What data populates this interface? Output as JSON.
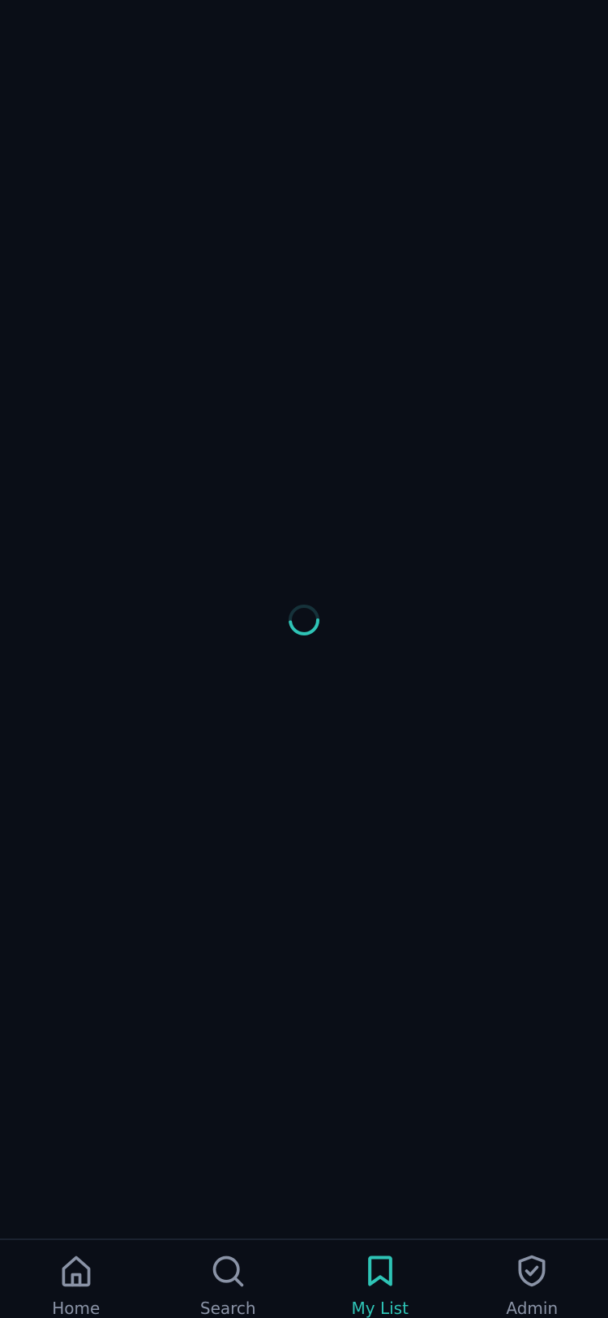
{
  "colors": {
    "background": "#0a0e17",
    "accent": "#2ec4b6",
    "inactive": "#8a93a6",
    "divider": "#1b2230"
  },
  "loading": {
    "spinner_icon": "loading-spinner-icon"
  },
  "tabbar": {
    "active_tab": "My List",
    "tabs": [
      {
        "label": "Home",
        "icon": "home-icon"
      },
      {
        "label": "Search",
        "icon": "search-icon"
      },
      {
        "label": "My List",
        "icon": "bookmark-icon"
      },
      {
        "label": "Admin",
        "icon": "shield-check-icon"
      }
    ]
  }
}
